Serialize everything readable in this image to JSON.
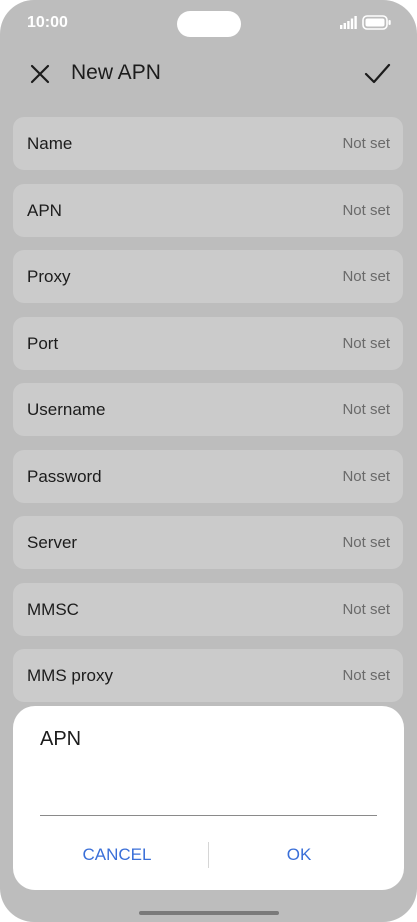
{
  "status_bar": {
    "time": "10:00"
  },
  "app_bar": {
    "title": "New APN"
  },
  "fields": [
    {
      "label": "Name",
      "value": "Not set"
    },
    {
      "label": "APN",
      "value": "Not set"
    },
    {
      "label": "Proxy",
      "value": "Not set"
    },
    {
      "label": "Port",
      "value": "Not set"
    },
    {
      "label": "Username",
      "value": "Not set"
    },
    {
      "label": "Password",
      "value": "Not set"
    },
    {
      "label": "Server",
      "value": "Not set"
    },
    {
      "label": "MMSC",
      "value": "Not set"
    },
    {
      "label": "MMS proxy",
      "value": "Not set"
    }
  ],
  "dialog": {
    "title": "APN",
    "input_value": "",
    "cancel_label": "CANCEL",
    "ok_label": "OK"
  },
  "colors": {
    "dim_background": "#bdbdbd",
    "row_background": "#cbcbcb",
    "accent": "#3a6fd8"
  }
}
